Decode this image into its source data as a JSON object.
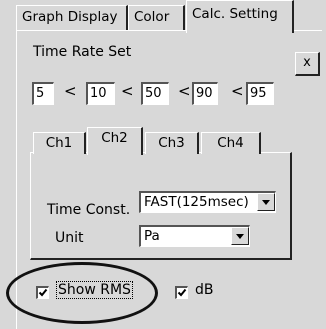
{
  "tabs": [
    {
      "label": "Graph Display"
    },
    {
      "label": "Color"
    },
    {
      "label": "Calc. Setting",
      "active": true
    }
  ],
  "time_rate": {
    "title": "Time Rate Set",
    "values": [
      "5",
      "10",
      "50",
      "90",
      "95"
    ],
    "separator": "<"
  },
  "close_label": "x",
  "channels": {
    "tabs": [
      "Ch1",
      "Ch2",
      "Ch3",
      "Ch4"
    ],
    "active": "Ch2",
    "time_const_label": "Time Const.",
    "time_const_value": "FAST(125msec)",
    "unit_label": "Unit",
    "unit_value": "Pa"
  },
  "show_rms": {
    "label": "Show RMS",
    "checked": true
  },
  "db": {
    "label": "dB",
    "checked": true
  }
}
